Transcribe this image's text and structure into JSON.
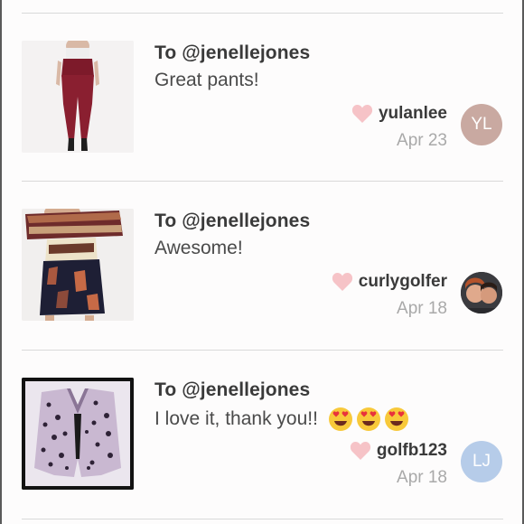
{
  "colors": {
    "heart": "#f6c3c7",
    "avatar_yl": "#c9a9a1",
    "avatar_lj": "#b6cce9"
  },
  "notes": [
    {
      "to": "To @jenellejones",
      "message": "Great pants!",
      "emojis": [],
      "username": "yulanlee",
      "date": "Apr 23",
      "avatar_initials": "YL",
      "avatar_type": "initials",
      "thumbnail": "burgundy-leggings-photo"
    },
    {
      "to": "To @jenellejones",
      "message": "Awesome!",
      "emojis": [],
      "username": "curlygolfer",
      "date": "Apr 18",
      "avatar_initials": "",
      "avatar_type": "photo",
      "thumbnail": "paisley-romper-photo"
    },
    {
      "to": "To @jenellejones",
      "message": "I love it, thank you!!",
      "emojis": [
        "heart-eyes-emoji",
        "heart-eyes-emoji",
        "heart-eyes-emoji"
      ],
      "username": "golfb123",
      "date": "Apr 18",
      "avatar_initials": "LJ",
      "avatar_type": "initials",
      "thumbnail": "leopard-jacket-photo"
    }
  ]
}
